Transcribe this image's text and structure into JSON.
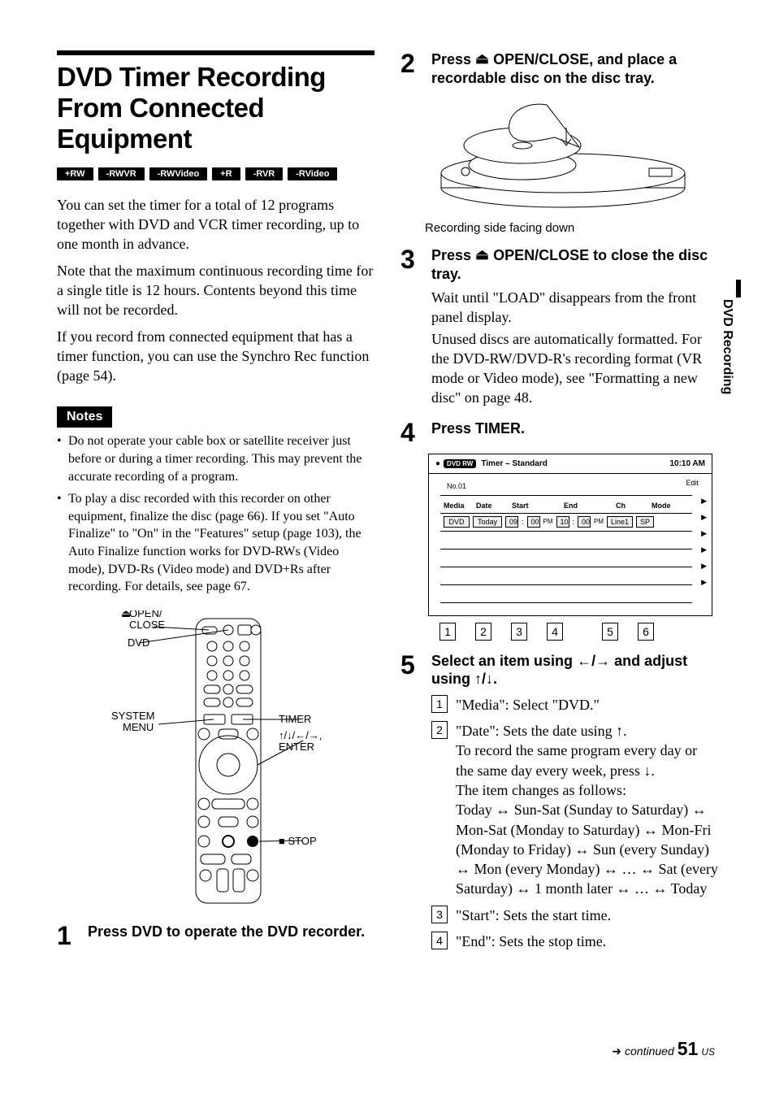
{
  "sidetab": "DVD Recording",
  "title": "DVD Timer Recording From Connected Equipment",
  "badges": [
    "+RW",
    "-RWVR",
    "-RWVideo",
    "+R",
    "-RVR",
    "-RVideo"
  ],
  "intro1": "You can set the timer for a total of 12 programs together with DVD and VCR timer recording, up to one month in advance.",
  "intro2": "Note that the maximum continuous recording time for a single title is 12 hours. Contents beyond this time will not be recorded.",
  "intro3": "If you record from connected equipment that has a timer function, you can use the Synchro Rec function (page 54).",
  "notes_label": "Notes",
  "note1": "Do not operate your cable box or satellite receiver just before or during a timer recording. This may prevent the accurate recording of a program.",
  "note2": "To play a disc recorded with this recorder on other equipment, finalize the disc (page 66). If you set \"Auto Finalize\" to \"On\" in the \"Features\" setup (page 103), the Auto Finalize function works for DVD-RWs (Video mode), DVD-Rs (Video mode) and DVD+Rs after recording. For details, see page 67.",
  "remote": {
    "open_close": "OPEN/\nCLOSE",
    "eject_glyph": "Z",
    "dvd": "DVD",
    "system_menu": "SYSTEM\nMENU",
    "timer": "TIMER",
    "arrows_enter": "M/m/</,,\nENTER",
    "stop": "x STOP"
  },
  "step1": {
    "num": "1",
    "head": "Press DVD to operate the DVD recorder."
  },
  "step2": {
    "num": "2",
    "head_a": "Press ",
    "head_b": " OPEN/CLOSE, and place a recordable disc on the disc tray.",
    "eject": "Z",
    "caption": "Recording side facing down"
  },
  "step3": {
    "num": "3",
    "head_a": "Press ",
    "head_b": " OPEN/CLOSE to close the disc tray.",
    "eject": "Z",
    "sub1": "Wait until \"LOAD\" disappears from the front panel display.",
    "sub2": "Unused discs are automatically formatted. For the DVD-RW/DVD-R's recording format (VR mode or Video mode), see \"Formatting a new disc\" on page 48."
  },
  "step4": {
    "num": "4",
    "head": "Press TIMER.",
    "screen": {
      "title": "Timer – Standard",
      "dvdlabel": "DVD\nRW",
      "clock": "10:10 AM",
      "no": "No.01",
      "edit": "Edit",
      "cols": [
        "Media",
        "Date",
        "Start",
        "End",
        "Ch",
        "Mode"
      ],
      "row": {
        "media": "DVD",
        "date": "Today",
        "start_h": "09",
        "start_m": "00",
        "start_ap": "PM",
        "end_h": "10",
        "end_m": "00",
        "end_ap": "PM",
        "ch": "Line1",
        "mode": "SP"
      }
    },
    "callouts": [
      "1",
      "2",
      "3",
      "4",
      "5",
      "6"
    ]
  },
  "step5": {
    "num": "5",
    "head": "Select an item using </, and adjust using M/m.",
    "items": {
      "i1": {
        "n": "1",
        "text": "\"Media\": Select \"DVD.\""
      },
      "i2": {
        "n": "2",
        "l1": "\"Date\": Sets the date using M.",
        "l2": "To record the same program every day or the same day every week, press m.",
        "l3": "The item changes as follows:",
        "l4": "Today y Sun-Sat (Sunday to Saturday) y Mon-Sat (Monday to Saturday) y Mon-Fri (Monday to Friday) y Sun (every Sunday) y Mon (every Monday) y … y Sat (every Saturday) y 1 month later y … y Today"
      },
      "i3": {
        "n": "3",
        "text": "\"Start\": Sets the start time."
      },
      "i4": {
        "n": "4",
        "text": "\"End\": Sets the stop time."
      }
    }
  },
  "footer": {
    "continued": "continued",
    "page": "51",
    "region": "US"
  }
}
